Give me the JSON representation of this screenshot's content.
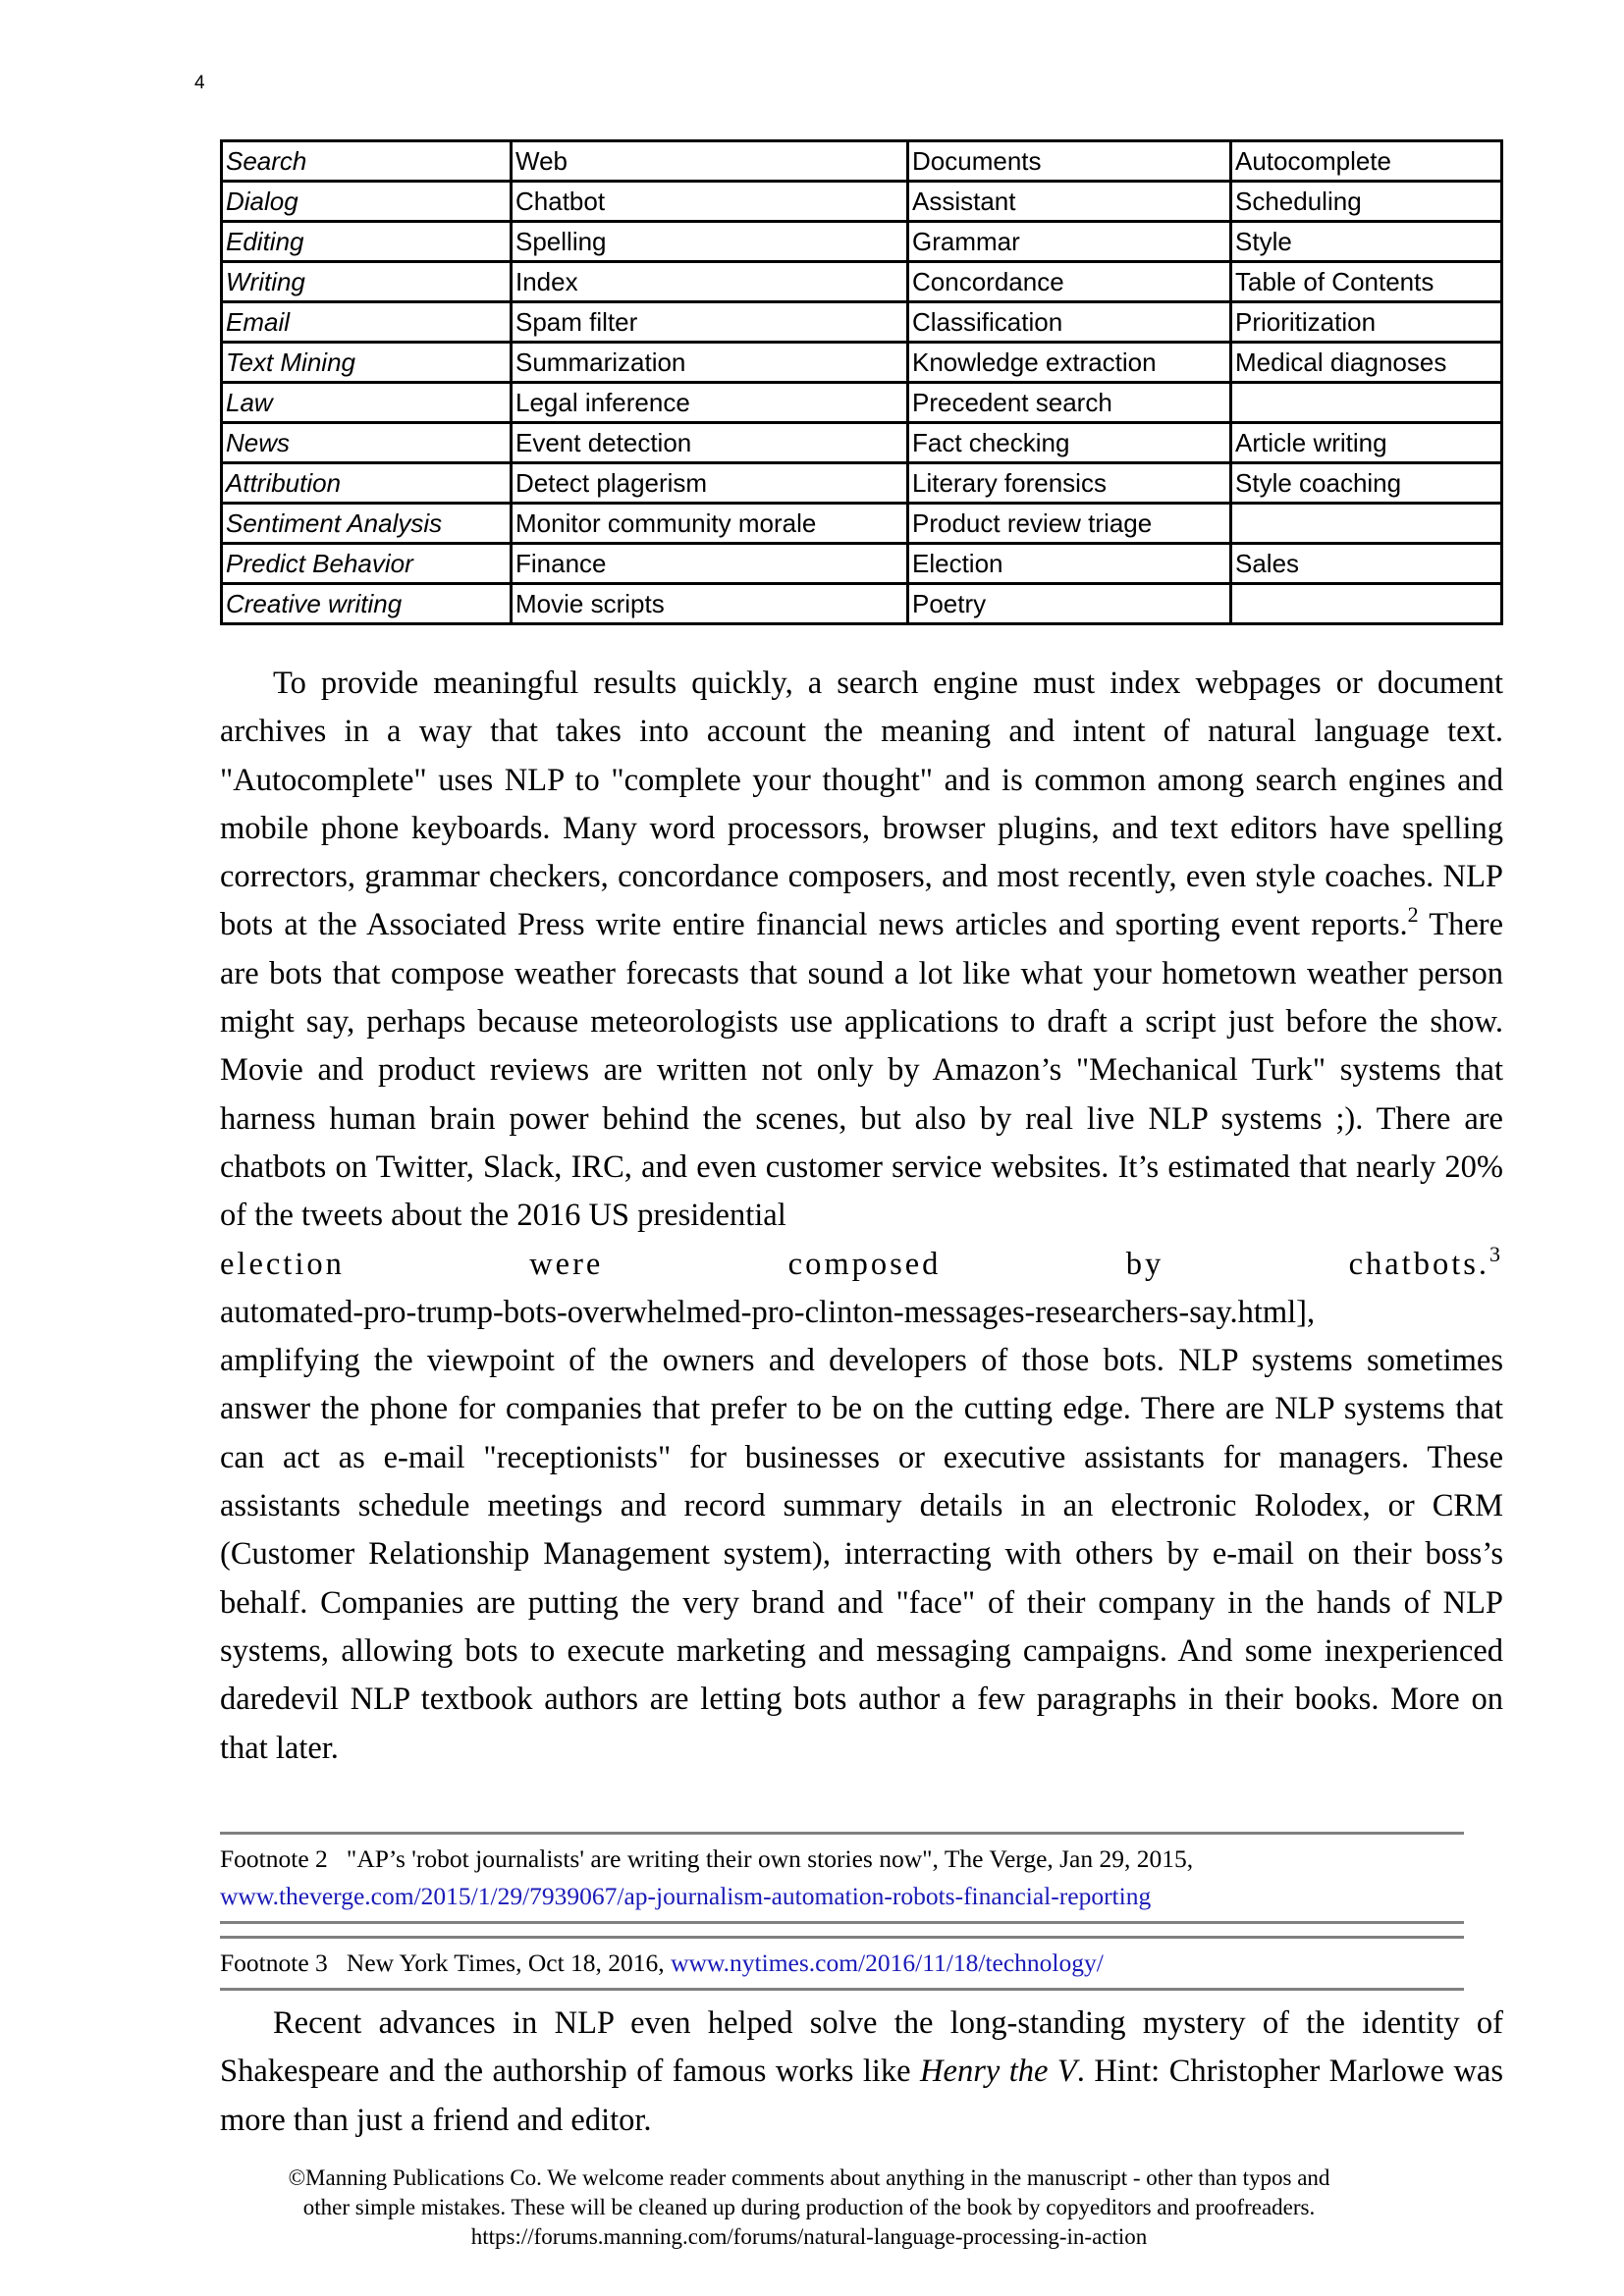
{
  "page_number": "4",
  "table": {
    "rows": [
      {
        "category": "Search",
        "c1": "Web",
        "c2": "Documents",
        "c3": "Autocomplete"
      },
      {
        "category": "Dialog",
        "c1": "Chatbot",
        "c2": "Assistant",
        "c3": "Scheduling"
      },
      {
        "category": "Editing",
        "c1": "Spelling",
        "c2": "Grammar",
        "c3": "Style"
      },
      {
        "category": "Writing",
        "c1": "Index",
        "c2": "Concordance",
        "c3": "Table of Contents"
      },
      {
        "category": "Email",
        "c1": "Spam filter",
        "c2": "Classification",
        "c3": "Prioritization"
      },
      {
        "category": "Text Mining",
        "c1": "Summarization",
        "c2": "Knowledge extraction",
        "c3": "Medical diagnoses"
      },
      {
        "category": "Law",
        "c1": "Legal inference",
        "c2": "Precedent search",
        "c3": ""
      },
      {
        "category": "News",
        "c1": "Event detection",
        "c2": "Fact checking",
        "c3": "Article writing"
      },
      {
        "category": "Attribution",
        "c1": "Detect plagerism",
        "c2": "Literary forensics",
        "c3": "Style coaching"
      },
      {
        "category": "Sentiment Analysis",
        "c1": "Monitor community morale",
        "c2": "Product review triage",
        "c3": ""
      },
      {
        "category": "Predict Behavior",
        "c1": "Finance",
        "c2": "Election",
        "c3": "Sales"
      },
      {
        "category": "Creative writing",
        "c1": "Movie scripts",
        "c2": "Poetry",
        "c3": ""
      }
    ]
  },
  "paragraph1": {
    "part1": "To provide meaningful results quickly, a search engine must index webpages or document archives in a way that takes into account the meaning and intent of natural language text. \"Autocomplete\" uses NLP to \"complete your thought\" and is common among search engines and mobile phone keyboards. Many word processors, browser plugins, and text editors have spelling correctors, grammar checkers, concordance composers, and most recently, even style coaches. NLP bots at the Associated Press write entire financial news articles and sporting event reports.",
    "footnote_ref_2": "2",
    "part2": " There are bots that compose weather forecasts that sound a lot like what your hometown weather person might say, perhaps because meteorologists use applications to draft a script just before the show. Movie and product reviews are written not only by Amazon’s \"Mechanical Turk\" systems that harness human brain power behind the scenes, but also by real live NLP systems ;). There are chatbots on Twitter, Slack, IRC, and even customer service websites. It’s estimated that nearly 20% of the tweets about the 2016 US presidential",
    "spaced_line": [
      "election",
      "were",
      "composed",
      "by",
      "chatbots."
    ],
    "footnote_ref_3": "3",
    "part3": "automated-pro-trump-bots-overwhelmed-pro-clinton-messages-researchers-say.html],",
    "part4": "amplifying the viewpoint of the owners and developers of those bots. NLP systems sometimes answer the phone for companies that prefer to be on the cutting edge. There are NLP systems that can act as e-mail \"receptionists\" for businesses or executive assistants for managers. These assistants schedule meetings and record summary details in an electronic Rolodex, or CRM (Customer Relationship Management system), interracting with others by e-mail on their boss’s behalf. Companies are putting the very brand and \"face\" of their company in the hands of NLP systems, allowing bots to execute marketing and messaging campaigns. And some inexperienced daredevil NLP textbook authors are letting bots author a few paragraphs in their books. More on that later."
  },
  "footnotes": [
    {
      "label": "Footnote 2",
      "text": "\"AP’s 'robot journalists' are writing their own stories now\", The Verge, Jan 29, 2015,",
      "link": "www.theverge.com/2015/1/29/7939067/ap-journalism-automation-robots-financial-reporting"
    },
    {
      "label": "Footnote 3",
      "text": "New York Times, Oct 18, 2016,",
      "link": "www.nytimes.com/2016/11/18/technology/"
    }
  ],
  "paragraph2": {
    "before": "Recent advances in NLP even helped solve the long-standing mystery of the identity of Shakespeare and the authorship of famous works like ",
    "italic": "Henry the V",
    "after": ". Hint: Christopher Marlowe was more than just a friend and editor."
  },
  "copyright": {
    "line1": "©Manning Publications Co. We welcome reader comments about anything in the manuscript - other than typos and",
    "line2": "other simple mistakes. These will be cleaned up during production of the book by copyeditors and proofreaders.",
    "line3": "https://forums.manning.com/forums/natural-language-processing-in-action"
  },
  "colors": {
    "link": "#1a1ab8",
    "rule": "#808080"
  }
}
